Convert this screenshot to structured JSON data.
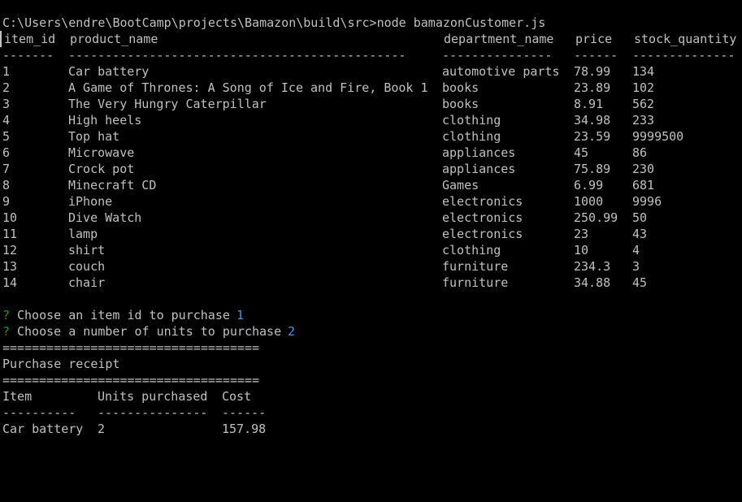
{
  "command_line": "C:\\Users\\endre\\BootCamp\\projects\\Bamazon\\build\\src>node bamazonCustomer.js",
  "table": {
    "headers": [
      "item_id",
      "product_name",
      "department_name",
      "price",
      "stock_quantity"
    ],
    "separators": [
      "-------",
      "----------------------------------------------",
      "---------------",
      "------",
      "--------------"
    ],
    "rows": [
      [
        "1",
        "Car battery",
        "automotive parts",
        "78.99",
        "134"
      ],
      [
        "2",
        "A Game of Thrones: A Song of Ice and Fire, Book 1",
        "books",
        "23.89",
        "102"
      ],
      [
        "3",
        "The Very Hungry Caterpillar",
        "books",
        "8.91",
        "562"
      ],
      [
        "4",
        "High heels",
        "clothing",
        "34.98",
        "233"
      ],
      [
        "5",
        "Top hat",
        "clothing",
        "23.59",
        "9999500"
      ],
      [
        "6",
        "Microwave",
        "appliances",
        "45",
        "86"
      ],
      [
        "7",
        "Crock pot",
        "appliances",
        "75.89",
        "230"
      ],
      [
        "8",
        "Minecraft CD",
        "Games",
        "6.99",
        "681"
      ],
      [
        "9",
        "iPhone",
        "electronics",
        "1000",
        "9996"
      ],
      [
        "10",
        "Dive Watch",
        "electronics",
        "250.99",
        "50"
      ],
      [
        "11",
        "lamp",
        "electronics",
        "23",
        "43"
      ],
      [
        "12",
        "shirt",
        "clothing",
        "10",
        "4"
      ],
      [
        "13",
        "couch",
        "furniture",
        "234.3",
        "3"
      ],
      [
        "14",
        "chair",
        "furniture",
        "34.88",
        "45"
      ]
    ]
  },
  "prompts": [
    {
      "mark": "?",
      "question": "Choose an item id to purchase",
      "answer": "1"
    },
    {
      "mark": "?",
      "question": "Choose a number of units to purchase",
      "answer": "2"
    }
  ],
  "receipt": {
    "rule": "===================================",
    "title": "Purchase receipt",
    "headers": [
      "Item",
      "Units purchased",
      "Cost"
    ],
    "separators": [
      "----------",
      "---------------",
      "------"
    ],
    "row": [
      "Car battery",
      "2",
      "157.98"
    ]
  },
  "colors": {
    "background": "#000000",
    "text": "#c0c0c0",
    "prompt_mark": "#13a10e",
    "answer": "#3a96dd"
  }
}
